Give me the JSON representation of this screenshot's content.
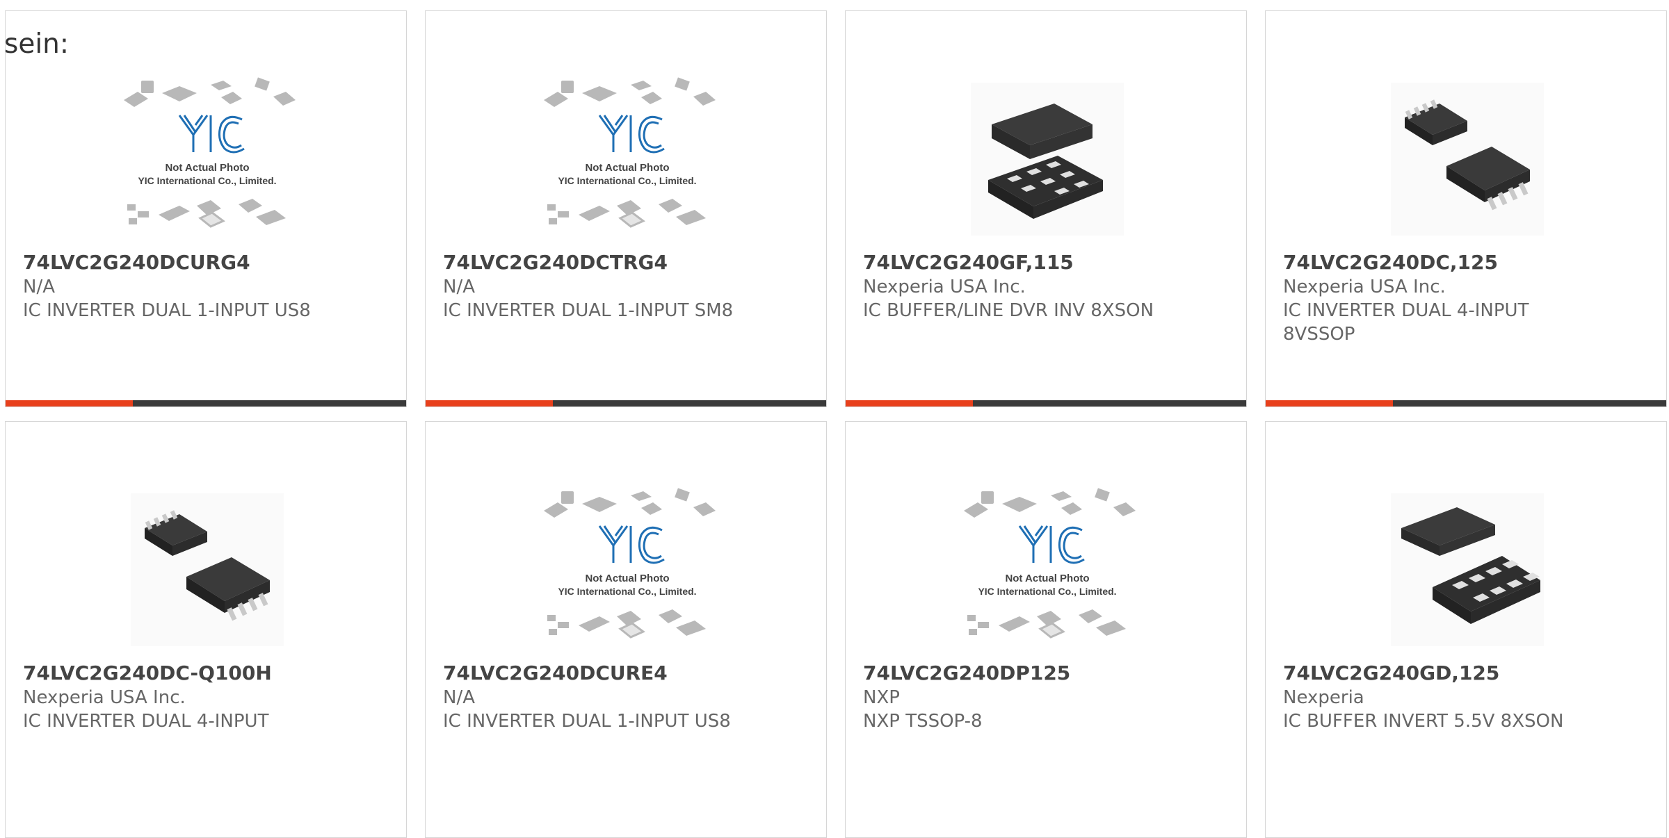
{
  "heading": "sein:",
  "products": [
    {
      "part": "74LVC2G240DCURG4",
      "manufacturer": "N/A",
      "description": "IC INVERTER DUAL 1-INPUT US8",
      "image": "placeholder"
    },
    {
      "part": "74LVC2G240DCTRG4",
      "manufacturer": "N/A",
      "description": "IC INVERTER DUAL 1-INPUT SM8",
      "image": "placeholder"
    },
    {
      "part": "74LVC2G240GF,115",
      "manufacturer": "Nexperia USA Inc.",
      "description": "IC BUFFER/LINE DVR INV 8XSON",
      "image": "xson-chip"
    },
    {
      "part": "74LVC2G240DC,125",
      "manufacturer": "Nexperia USA Inc.",
      "description": "IC INVERTER DUAL 4-INPUT 8VSSOP",
      "image": "vssop-chip"
    },
    {
      "part": "74LVC2G240DC-Q100H",
      "manufacturer": "Nexperia USA Inc.",
      "description": "IC INVERTER DUAL 4-INPUT",
      "image": "vssop-chip"
    },
    {
      "part": "74LVC2G240DCURE4",
      "manufacturer": "N/A",
      "description": "IC INVERTER DUAL 1-INPUT US8",
      "image": "placeholder"
    },
    {
      "part": "74LVC2G240DP125",
      "manufacturer": "NXP",
      "description": "NXP TSSOP-8",
      "image": "placeholder"
    },
    {
      "part": "74LVC2G240GD,125",
      "manufacturer": "Nexperia",
      "description": "IC BUFFER INVERT 5.5V 8XSON",
      "image": "xson-chip-2"
    }
  ],
  "placeholder": {
    "logo": "YIC",
    "line1": "Not Actual Photo",
    "line2": "YIC International Co., Limited."
  },
  "colors": {
    "accent": "#e8401c",
    "bar": "#3a3a3a"
  }
}
